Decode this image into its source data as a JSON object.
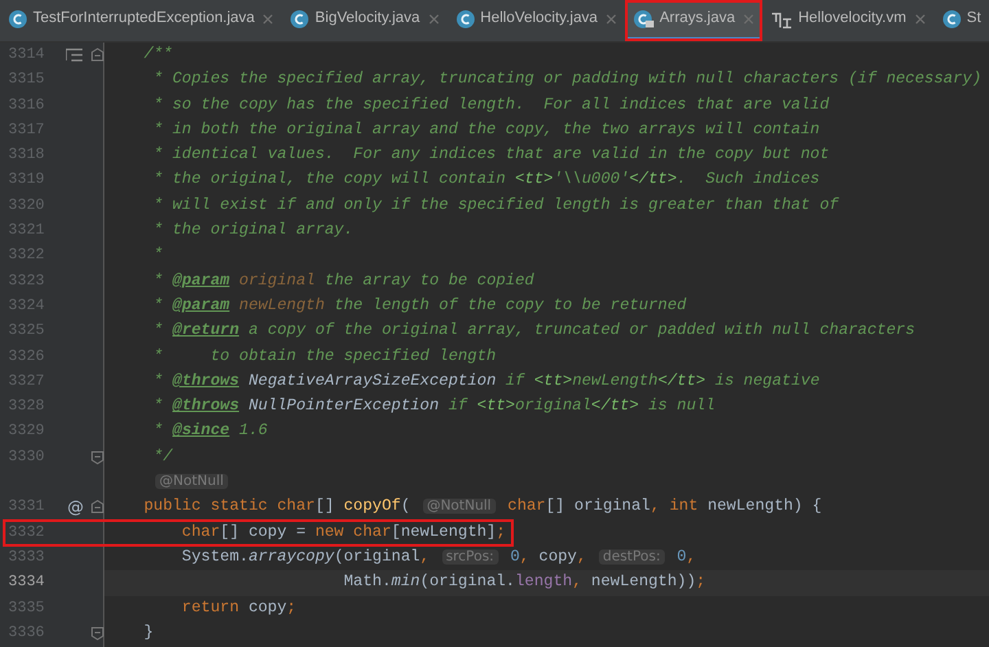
{
  "tabs": [
    {
      "label": "TestForInterruptedException.java",
      "kind": "class",
      "selected": false,
      "boxed": false
    },
    {
      "label": "BigVelocity.java",
      "kind": "class",
      "selected": false,
      "boxed": false
    },
    {
      "label": "HelloVelocity.java",
      "kind": "class",
      "selected": false,
      "boxed": false
    },
    {
      "label": "Arrays.java",
      "kind": "locked",
      "selected": true,
      "boxed": true
    },
    {
      "label": "Hellovelocity.vm",
      "kind": "template",
      "selected": false,
      "boxed": false
    },
    {
      "label": "St",
      "kind": "class",
      "selected": false,
      "boxed": false
    }
  ],
  "lines": [
    {
      "number": "3314",
      "doc_marker": true,
      "fold_start": true,
      "current": false,
      "boxed": false,
      "tokens": [
        {
          "kind": "c",
          "text": "    /**"
        }
      ]
    },
    {
      "number": "3315",
      "current": false,
      "boxed": false,
      "tokens": [
        {
          "kind": "c",
          "text": "     * Copies the specified array, truncating or padding with null characters (if necessary)"
        }
      ]
    },
    {
      "number": "3316",
      "current": false,
      "boxed": false,
      "tokens": [
        {
          "kind": "c",
          "text": "     * so the copy has the specified length.  For all indices that are valid"
        }
      ]
    },
    {
      "number": "3317",
      "current": false,
      "boxed": false,
      "tokens": [
        {
          "kind": "c",
          "text": "     * in both the original array and the copy, the two arrays will contain"
        }
      ]
    },
    {
      "number": "3318",
      "current": false,
      "boxed": false,
      "tokens": [
        {
          "kind": "c",
          "text": "     * identical values.  For any indices that are valid in the copy but not"
        }
      ]
    },
    {
      "number": "3319",
      "current": false,
      "boxed": false,
      "tokens": [
        {
          "kind": "c",
          "text": "     * the original, the copy will contain "
        },
        {
          "kind": "tt",
          "text": "<tt>"
        },
        {
          "kind": "c",
          "text": "'\\\\u000'"
        },
        {
          "kind": "tt",
          "text": "</tt>"
        },
        {
          "kind": "c",
          "text": ".  Such indices"
        }
      ]
    },
    {
      "number": "3320",
      "current": false,
      "boxed": false,
      "tokens": [
        {
          "kind": "c",
          "text": "     * will exist if and only if the specified length is greater than that of"
        }
      ]
    },
    {
      "number": "3321",
      "current": false,
      "boxed": false,
      "tokens": [
        {
          "kind": "c",
          "text": "     * the original array."
        }
      ]
    },
    {
      "number": "3322",
      "current": false,
      "boxed": false,
      "tokens": [
        {
          "kind": "c",
          "text": "     *"
        }
      ]
    },
    {
      "number": "3323",
      "current": false,
      "boxed": false,
      "tokens": [
        {
          "kind": "c",
          "text": "     * "
        },
        {
          "kind": "tag",
          "text": "@param"
        },
        {
          "kind": "pn",
          "text": " original"
        },
        {
          "kind": "c",
          "text": " the array to be copied"
        }
      ]
    },
    {
      "number": "3324",
      "current": false,
      "boxed": false,
      "tokens": [
        {
          "kind": "c",
          "text": "     * "
        },
        {
          "kind": "tag",
          "text": "@param"
        },
        {
          "kind": "pn",
          "text": " newLength"
        },
        {
          "kind": "c",
          "text": " the length of the copy to be returned"
        }
      ]
    },
    {
      "number": "3325",
      "current": false,
      "boxed": false,
      "tokens": [
        {
          "kind": "c",
          "text": "     * "
        },
        {
          "kind": "tag",
          "text": "@return"
        },
        {
          "kind": "c",
          "text": " a copy of the original array, truncated or padded with null characters"
        }
      ]
    },
    {
      "number": "3326",
      "current": false,
      "boxed": false,
      "tokens": [
        {
          "kind": "c",
          "text": "     *     to obtain the specified length"
        }
      ]
    },
    {
      "number": "3327",
      "current": false,
      "boxed": false,
      "tokens": [
        {
          "kind": "c",
          "text": "     * "
        },
        {
          "kind": "tag",
          "text": "@throws"
        },
        {
          "kind": "ref",
          "text": " NegativeArraySizeException"
        },
        {
          "kind": "c",
          "text": " if "
        },
        {
          "kind": "tt",
          "text": "<tt>"
        },
        {
          "kind": "c",
          "text": "newLength"
        },
        {
          "kind": "tt",
          "text": "</tt>"
        },
        {
          "kind": "c",
          "text": " is negative"
        }
      ]
    },
    {
      "number": "3328",
      "current": false,
      "boxed": false,
      "tokens": [
        {
          "kind": "c",
          "text": "     * "
        },
        {
          "kind": "tag",
          "text": "@throws"
        },
        {
          "kind": "ref",
          "text": " NullPointerException"
        },
        {
          "kind": "c",
          "text": " if "
        },
        {
          "kind": "tt",
          "text": "<tt>"
        },
        {
          "kind": "c",
          "text": "original"
        },
        {
          "kind": "tt",
          "text": "</tt>"
        },
        {
          "kind": "c",
          "text": " is null"
        }
      ]
    },
    {
      "number": "3329",
      "current": false,
      "boxed": false,
      "tokens": [
        {
          "kind": "c",
          "text": "     * "
        },
        {
          "kind": "tag",
          "text": "@since"
        },
        {
          "kind": "c",
          "text": " 1.6"
        }
      ]
    },
    {
      "number": "3330",
      "fold_end": true,
      "current": false,
      "boxed": false,
      "tokens": [
        {
          "kind": "c",
          "text": "     */"
        }
      ]
    },
    {
      "current": false,
      "boxed": false,
      "tokens": [
        {
          "kind": "hint",
          "text": "@NotNull"
        }
      ]
    },
    {
      "number": "3331",
      "gutter_text": "@",
      "fold_start": true,
      "current": false,
      "boxed": false,
      "tokens": [
        {
          "kind": "kw",
          "text": "    public static char"
        },
        {
          "kind": "id",
          "text": "[] "
        },
        {
          "kind": "fn",
          "text": "copyOf"
        },
        {
          "kind": "id",
          "text": "( "
        },
        {
          "kind": "hint",
          "text": "@NotNull"
        },
        {
          "kind": "kw",
          "text": " char"
        },
        {
          "kind": "id",
          "text": "[] original"
        },
        {
          "kind": "kw",
          "text": ", int"
        },
        {
          "kind": "id",
          "text": " newLength) {"
        }
      ]
    },
    {
      "number": "3332",
      "current": false,
      "boxed": true,
      "tokens": [
        {
          "kind": "kw",
          "text": "        char"
        },
        {
          "kind": "id",
          "text": "[] copy = "
        },
        {
          "kind": "kw",
          "text": "new char"
        },
        {
          "kind": "id",
          "text": "[newLength]"
        },
        {
          "kind": "kw",
          "text": ";"
        }
      ]
    },
    {
      "number": "3333",
      "current": false,
      "boxed": false,
      "tokens": [
        {
          "kind": "id",
          "text": "        System."
        },
        {
          "kind": "st",
          "text": "arraycopy"
        },
        {
          "kind": "id",
          "text": "(original"
        },
        {
          "kind": "kw",
          "text": ", "
        },
        {
          "kind": "hint",
          "text": "srcPos:"
        },
        {
          "kind": "num",
          "text": " 0"
        },
        {
          "kind": "kw",
          "text": ", "
        },
        {
          "kind": "id",
          "text": "copy"
        },
        {
          "kind": "kw",
          "text": ", "
        },
        {
          "kind": "hint",
          "text": "destPos:"
        },
        {
          "kind": "num",
          "text": " 0"
        },
        {
          "kind": "kw",
          "text": ","
        }
      ]
    },
    {
      "number": "3334",
      "current": true,
      "boxed": false,
      "tokens": [
        {
          "kind": "id",
          "text": "                         Math."
        },
        {
          "kind": "st",
          "text": "min"
        },
        {
          "kind": "id",
          "text": "(original."
        },
        {
          "kind": "fld",
          "text": "length"
        },
        {
          "kind": "kw",
          "text": ", "
        },
        {
          "kind": "id",
          "text": "newLength))"
        },
        {
          "kind": "kw",
          "text": ";"
        }
      ]
    },
    {
      "number": "3335",
      "current": false,
      "boxed": false,
      "tokens": [
        {
          "kind": "kw",
          "text": "        return "
        },
        {
          "kind": "id",
          "text": "copy"
        },
        {
          "kind": "kw",
          "text": ";"
        }
      ]
    },
    {
      "number": "3336",
      "fold_end": true,
      "current": false,
      "boxed": false,
      "tokens": [
        {
          "kind": "id",
          "text": "    }"
        }
      ]
    }
  ]
}
